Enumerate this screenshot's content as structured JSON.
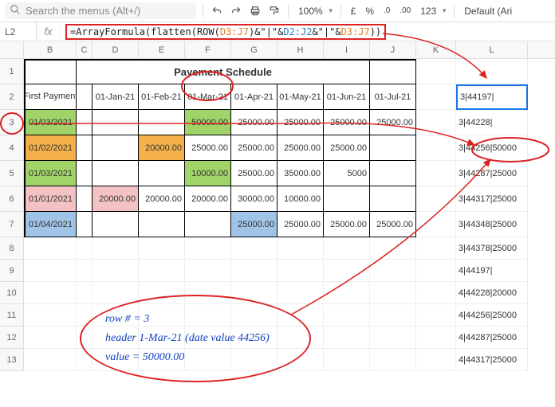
{
  "toolbar": {
    "search_placeholder": "Search the menus (Alt+/)",
    "zoom": "100%",
    "currency1": "£",
    "currency2": "%",
    "decimal_dec": ".0",
    "decimal_inc": ".00",
    "format": "123",
    "font": "Default (Ari"
  },
  "namebox": "L2",
  "fx": "fx",
  "formula": {
    "p1": "=ArrayFormula(flatten(ROW(",
    "r1": "D3:J7",
    "p2": ")&\"|\"&",
    "r2": "D2:J2",
    "p3": "&\"|\"&",
    "r3": "D3:J7",
    "p4": "))"
  },
  "cols": [
    "B",
    "C",
    "D",
    "E",
    "F",
    "G",
    "H",
    "I",
    "J",
    "K",
    "L"
  ],
  "rows": [
    "1",
    "2",
    "3",
    "4",
    "5",
    "6",
    "7",
    "8",
    "9",
    "10",
    "11",
    "12",
    "13"
  ],
  "table": {
    "title": "Payement Schedule",
    "header_first": "First Payment",
    "dates": [
      "01-Jan-21",
      "01-Feb-21",
      "01-Mar-21",
      "01-Apr-21",
      "01-May-21",
      "01-Jun-21",
      "01-Jul-21"
    ],
    "rows": [
      {
        "b": "01/03/2021",
        "d": "",
        "e": "",
        "f": "50000.00",
        "g": "25000.00",
        "h": "25000.00",
        "i": "25000.00",
        "j": "25000.00"
      },
      {
        "b": "01/02/2021",
        "d": "",
        "e": "20000.00",
        "f": "25000.00",
        "g": "25000.00",
        "h": "25000.00",
        "i": "25000.00",
        "j": ""
      },
      {
        "b": "01/03/2021",
        "d": "",
        "e": "",
        "f": "10000.00",
        "g": "25000.00",
        "h": "35000.00",
        "i": "5000",
        "j": ""
      },
      {
        "b": "01/01/2021",
        "d": "20000.00",
        "e": "20000.00",
        "f": "20000.00",
        "g": "30000.00",
        "h": "10000.00",
        "i": "",
        "j": ""
      },
      {
        "b": "01/04/2021",
        "d": "",
        "e": "",
        "f": "",
        "g": "25000.00",
        "h": "25000.00",
        "i": "25000.00",
        "j": "25000.00"
      }
    ]
  },
  "L": [
    "3|44197|",
    "3|44228|",
    "3|44256|50000",
    "3|44287|25000",
    "3|44317|25000",
    "3|44348|25000",
    "3|44378|25000",
    "4|44197|",
    "4|44228|20000",
    "4|44256|25000",
    "4|44287|25000",
    "4|44317|25000"
  ],
  "annotation": {
    "l1": "row # = 3",
    "l2": "header 1-Mar-21 (date value 44256)",
    "l3": "value = 50000.00"
  },
  "chart_data": {
    "type": "table",
    "title": "Payement Schedule",
    "columns": [
      "First Payment",
      "01-Jan-21",
      "01-Feb-21",
      "01-Mar-21",
      "01-Apr-21",
      "01-May-21",
      "01-Jun-21",
      "01-Jul-21"
    ],
    "rows": [
      [
        "01/03/2021",
        null,
        null,
        50000.0,
        25000.0,
        25000.0,
        25000.0,
        25000.0
      ],
      [
        "01/02/2021",
        null,
        20000.0,
        25000.0,
        25000.0,
        25000.0,
        25000.0,
        null
      ],
      [
        "01/03/2021",
        null,
        null,
        10000.0,
        25000.0,
        35000.0,
        5000,
        null
      ],
      [
        "01/01/2021",
        20000.0,
        20000.0,
        20000.0,
        30000.0,
        10000.0,
        null,
        null
      ],
      [
        "01/04/2021",
        null,
        null,
        null,
        25000.0,
        25000.0,
        25000.0,
        25000.0
      ]
    ],
    "flattened_output_sample": [
      "3|44197|",
      "3|44228|",
      "3|44256|50000",
      "3|44287|25000",
      "3|44317|25000",
      "3|44348|25000",
      "3|44378|25000",
      "4|44197|",
      "4|44228|20000",
      "4|44256|25000",
      "4|44287|25000",
      "4|44317|25000"
    ]
  }
}
